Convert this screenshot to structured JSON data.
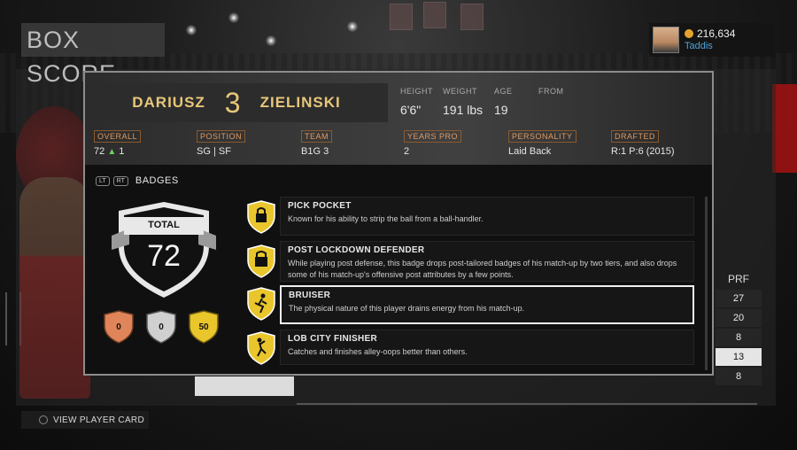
{
  "screen": {
    "title": "BOX SCORE"
  },
  "user": {
    "vc": "216,634",
    "name": "Taddis"
  },
  "player": {
    "first_name": "DARIUSZ",
    "number": "3",
    "last_name": "ZIELINSKI",
    "height_label": "HEIGHT",
    "height": "6'6\"",
    "weight_label": "WEIGHT",
    "weight": "191 lbs",
    "age_label": "AGE",
    "age": "19",
    "from_label": "FROM"
  },
  "info": {
    "overall_label": "OVERALL",
    "overall_value": "72",
    "overall_change": "1",
    "position_label": "POSITION",
    "position_value": "SG | SF",
    "team_label": "TEAM",
    "team_value": "B1G 3",
    "years_label": "YEARS PRO",
    "years_value": "2",
    "personality_label": "PERSONALITY",
    "personality_value": "Laid Back",
    "drafted_label": "DRAFTED",
    "drafted_value": "R:1 P:6 (2015)"
  },
  "badges": {
    "lt_label": "LT",
    "rt_label": "RT",
    "title": "BADGES",
    "total_label": "TOTAL",
    "total_value": "72",
    "tiers": [
      {
        "value": "0",
        "color": "#e0855a"
      },
      {
        "value": "0",
        "color": "#d0d0d0"
      },
      {
        "value": "50",
        "color": "#e9c62b"
      }
    ],
    "items": [
      {
        "name": "PICK POCKET",
        "desc": "Known for his ability to strip the ball from a ball-handler.",
        "icon": "hand-lock-icon"
      },
      {
        "name": "POST LOCKDOWN DEFENDER",
        "desc": "While playing post defense, this badge drops post-tailored badges of his match-up by two tiers, and also drops some of his match-up's offensive post attributes by a few points.",
        "icon": "lock-shield-icon"
      },
      {
        "name": "BRUISER",
        "desc": "The physical nature of this player drains energy from his match-up.",
        "icon": "runner-icon"
      },
      {
        "name": "LOB CITY FINISHER",
        "desc": "Catches and finishes alley-oops better than others.",
        "icon": "dunk-icon"
      }
    ]
  },
  "boxscore": {
    "column_header": "PRF",
    "values": [
      "27",
      "20",
      "8",
      "13",
      "8"
    ],
    "selected_index": 3
  },
  "footer": {
    "view_card_label": "VIEW PLAYER CARD"
  },
  "colors": {
    "accent_gold": "#e8c77a",
    "label_orange": "#e09a62",
    "badge_gold": "#e9c62b"
  }
}
